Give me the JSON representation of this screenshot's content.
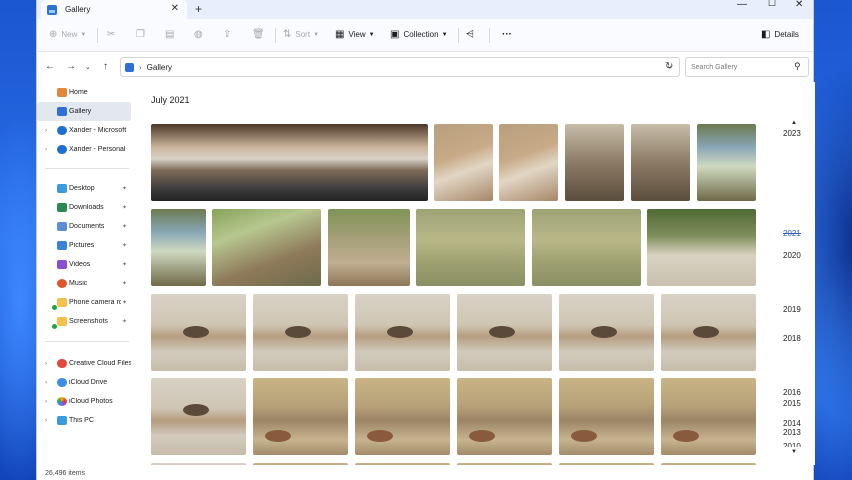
{
  "tab": {
    "title": "Gallery"
  },
  "commands": {
    "new": "New",
    "sort": "Sort",
    "view": "View",
    "collection": "Collection",
    "details": "Details"
  },
  "address": {
    "location": "Gallery"
  },
  "search": {
    "placeholder": "Search Gallery"
  },
  "sidebar": {
    "items": [
      {
        "label": "Home",
        "icon": "home-icon"
      },
      {
        "label": "Gallery",
        "icon": "gallery-icon"
      },
      {
        "label": "Xander - Microsoft",
        "icon": "cloud-icon"
      },
      {
        "label": "Xander - Personal",
        "icon": "cloud-icon"
      },
      {
        "label": "Desktop",
        "icon": "desktop-icon"
      },
      {
        "label": "Downloads",
        "icon": "download-icon"
      },
      {
        "label": "Documents",
        "icon": "documents-icon"
      },
      {
        "label": "Pictures",
        "icon": "pictures-icon"
      },
      {
        "label": "Videos",
        "icon": "videos-icon"
      },
      {
        "label": "Music",
        "icon": "music-icon"
      },
      {
        "label": "Phone camera roll",
        "icon": "folder-icon"
      },
      {
        "label": "Screenshots",
        "icon": "folder-icon"
      },
      {
        "label": "Creative Cloud Files",
        "icon": "creative-cloud-icon"
      },
      {
        "label": "iCloud Drive",
        "icon": "icloud-icon"
      },
      {
        "label": "iCloud Photos",
        "icon": "icloud-photos-icon"
      },
      {
        "label": "This PC",
        "icon": "pc-icon"
      }
    ]
  },
  "main": {
    "month": "July 2021"
  },
  "timeline": {
    "years": [
      "2023",
      "2021",
      "2020",
      "2019",
      "2018",
      "2016",
      "2015",
      "2014",
      "2013",
      "2010"
    ],
    "selected": "2021"
  },
  "status": {
    "item_count": "26,496 items"
  },
  "colors": {
    "accent": "#2b5fc0",
    "selection": "#e3e7ee"
  }
}
